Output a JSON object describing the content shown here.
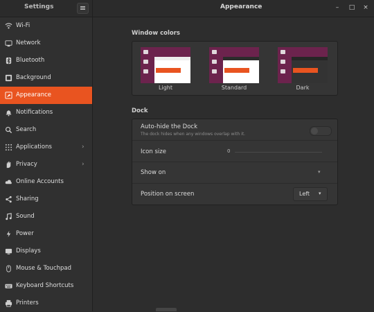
{
  "header": {
    "sidebar_title": "Settings",
    "window_title": "Appearance",
    "minimize": "–",
    "maximize": "□",
    "close": "×"
  },
  "sidebar": {
    "items": [
      {
        "label": "Wi-Fi",
        "icon": "wifi-icon"
      },
      {
        "label": "Network",
        "icon": "network-icon"
      },
      {
        "label": "Bluetooth",
        "icon": "bluetooth-icon"
      },
      {
        "label": "Background",
        "icon": "background-icon"
      },
      {
        "label": "Appearance",
        "icon": "appearance-icon",
        "active": true
      },
      {
        "label": "Notifications",
        "icon": "bell-icon"
      },
      {
        "label": "Search",
        "icon": "search-icon"
      },
      {
        "label": "Applications",
        "icon": "grid-icon",
        "chevron": "›"
      },
      {
        "label": "Privacy",
        "icon": "hand-icon",
        "chevron": "›"
      },
      {
        "label": "Online Accounts",
        "icon": "cloud-icon"
      },
      {
        "label": "Sharing",
        "icon": "share-icon"
      },
      {
        "label": "Sound",
        "icon": "music-icon"
      },
      {
        "label": "Power",
        "icon": "power-icon"
      },
      {
        "label": "Displays",
        "icon": "display-icon"
      },
      {
        "label": "Mouse & Touchpad",
        "icon": "mouse-icon"
      },
      {
        "label": "Keyboard Shortcuts",
        "icon": "keyboard-icon"
      },
      {
        "label": "Printers",
        "icon": "printer-icon"
      }
    ]
  },
  "window_colors": {
    "heading": "Window colors",
    "themes": [
      {
        "label": "Light"
      },
      {
        "label": "Standard"
      },
      {
        "label": "Dark"
      }
    ]
  },
  "dock": {
    "heading": "Dock",
    "autohide_title": "Auto-hide the Dock",
    "autohide_sub": "The dock hides when any windows overlap with it.",
    "icon_size_label": "Icon size",
    "icon_size_value": "0",
    "show_on_label": "Show on",
    "position_label": "Position on screen",
    "position_value": "Left"
  },
  "colors": {
    "accent": "#e95420",
    "aubergine": "#5e2750"
  }
}
